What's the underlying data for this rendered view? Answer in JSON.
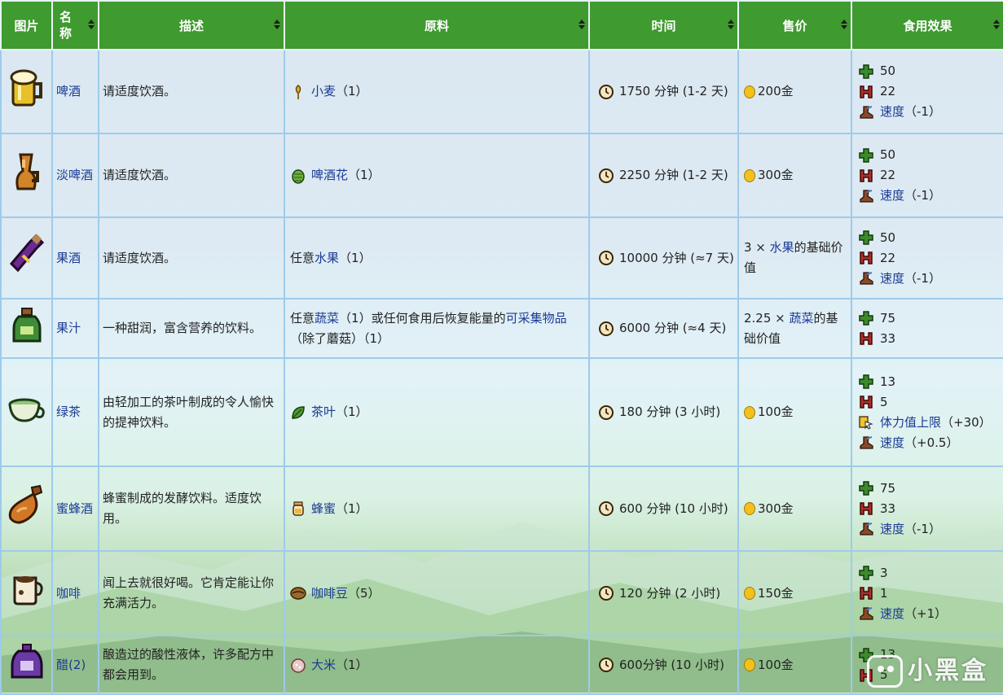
{
  "headers": [
    "图片",
    "名称",
    "描述",
    "原料",
    "时间",
    "售价",
    "食用效果"
  ],
  "rows": [
    {
      "name": "啤酒",
      "desc": "请适度饮酒。",
      "ing_pre": "",
      "ing_link": "小麦",
      "ing_mid": "（1）",
      "ing_link2": "",
      "ing_post": "",
      "time": "1750 分钟 (1-2 天)",
      "price": "200金",
      "price_pre": "",
      "price_link": "",
      "price_post": "",
      "energy": "50",
      "health": "22",
      "buff": "速度",
      "buff_val": "（-1）"
    },
    {
      "name": "淡啤酒",
      "desc": "请适度饮酒。",
      "ing_pre": "",
      "ing_link": "啤酒花",
      "ing_mid": "（1）",
      "ing_link2": "",
      "ing_post": "",
      "time": "2250 分钟 (1-2 天)",
      "price": "300金",
      "price_pre": "",
      "price_link": "",
      "price_post": "",
      "energy": "50",
      "health": "22",
      "buff": "速度",
      "buff_val": "（-1）"
    },
    {
      "name": "果酒",
      "desc": "请适度饮酒。",
      "ing_pre": "任意",
      "ing_link": "水果",
      "ing_mid": "（1）",
      "ing_link2": "",
      "ing_post": "",
      "time": "10000 分钟 (≈7 天)",
      "price": "",
      "price_pre": "3 × ",
      "price_link": "水果",
      "price_post": "的基础价值",
      "energy": "50",
      "health": "22",
      "buff": "速度",
      "buff_val": "（-1）"
    },
    {
      "name": "果汁",
      "desc": "一种甜润，富含营养的饮料。",
      "ing_pre": "任意",
      "ing_link": "蔬菜",
      "ing_mid": "（1）或任何食用后恢复能量的",
      "ing_link2": "可采集物品",
      "ing_post": "（除了蘑菇）（1）",
      "time": "6000 分钟 (≈4 天)",
      "price": "",
      "price_pre": "2.25 × ",
      "price_link": "蔬菜",
      "price_post": "的基础价值",
      "energy": "75",
      "health": "33",
      "buff": "",
      "buff_val": ""
    },
    {
      "name": "绿茶",
      "desc": "由轻加工的茶叶制成的令人愉快的提神饮料。",
      "ing_pre": "",
      "ing_link": "茶叶",
      "ing_mid": "（1）",
      "ing_link2": "",
      "ing_post": "",
      "time": "180 分钟 (3 小时)",
      "price": "100金",
      "price_pre": "",
      "price_link": "",
      "price_post": "",
      "energy": "13",
      "health": "5",
      "buff2": "体力值上限",
      "buff2_val": "（+30）",
      "buff": "速度",
      "buff_val": "（+0.5）"
    },
    {
      "name": "蜜蜂酒",
      "desc": "蜂蜜制成的发酵饮料。适度饮用。",
      "ing_pre": "",
      "ing_link": "蜂蜜",
      "ing_mid": "（1）",
      "ing_link2": "",
      "ing_post": "",
      "time": "600 分钟 (10 小时)",
      "price": "300金",
      "price_pre": "",
      "price_link": "",
      "price_post": "",
      "energy": "75",
      "health": "33",
      "buff": "速度",
      "buff_val": "（-1）"
    },
    {
      "name": "咖啡",
      "desc": "闻上去就很好喝。它肯定能让你充满活力。",
      "ing_pre": "",
      "ing_link": "咖啡豆",
      "ing_mid": "（5）",
      "ing_link2": "",
      "ing_post": "",
      "time": "120 分钟 (2 小时)",
      "price": "150金",
      "price_pre": "",
      "price_link": "",
      "price_post": "",
      "energy": "3",
      "health": "1",
      "buff": "速度",
      "buff_val": "（+1）"
    },
    {
      "name": "醋(2)",
      "desc": "酿造过的酸性液体，许多配方中都会用到。",
      "ing_pre": "",
      "ing_link": "大米",
      "ing_mid": "（1）",
      "ing_link2": "",
      "ing_post": "",
      "time": "600分钟 (10 小时)",
      "price": "100金",
      "price_pre": "",
      "price_link": "",
      "price_post": "",
      "energy": "13",
      "health": "5",
      "buff": "",
      "buff_val": ""
    }
  ],
  "watermark": "小黑盒",
  "colors": {
    "header": "#3f9a2f",
    "link": "#1b3a94",
    "border": "#9ecbeb",
    "coin": "#f2c21b"
  }
}
